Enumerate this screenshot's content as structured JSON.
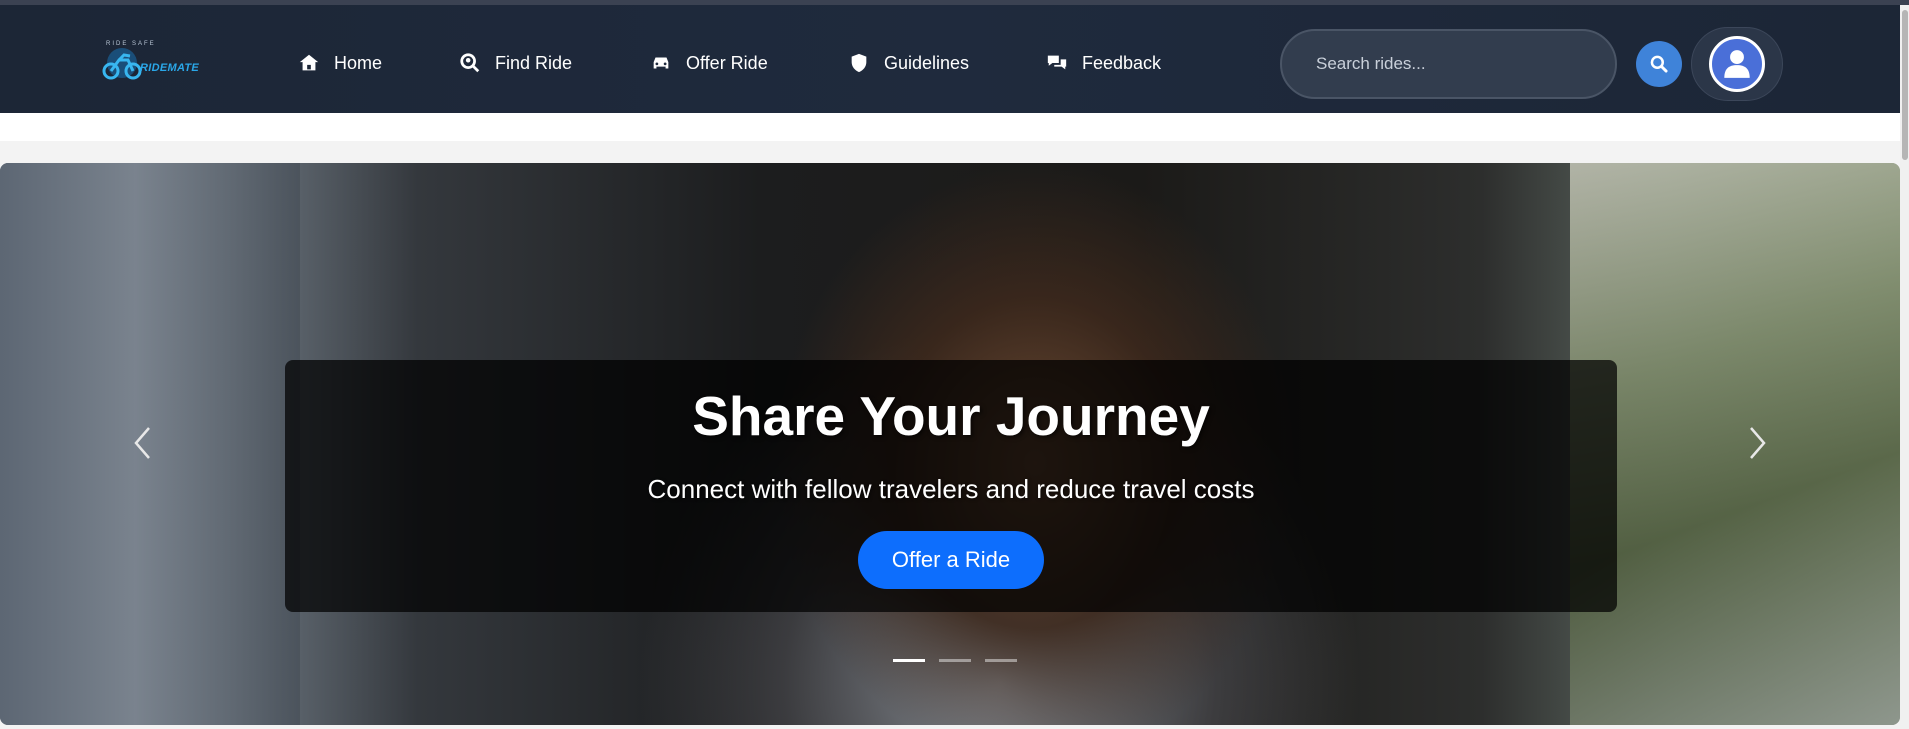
{
  "brand": {
    "name": "RIDEMATE",
    "tagline": "RIDE SAFE"
  },
  "nav": {
    "items": [
      {
        "label": "Home",
        "icon": "home-icon"
      },
      {
        "label": "Find Ride",
        "icon": "search-location-icon"
      },
      {
        "label": "Offer Ride",
        "icon": "car-icon"
      },
      {
        "label": "Guidelines",
        "icon": "shield-icon"
      },
      {
        "label": "Feedback",
        "icon": "comments-icon"
      }
    ]
  },
  "search": {
    "placeholder": "Search rides..."
  },
  "colors": {
    "navbar": "#1f2a3d",
    "accent": "#0d6efd",
    "search_button": "#3f83d9",
    "avatar": "#4a6fd8"
  },
  "hero": {
    "title": "Share Your Journey",
    "subtitle": "Connect with fellow travelers and reduce travel costs",
    "cta_label": "Offer a Ride",
    "slides_count": 3,
    "active_slide": 1
  }
}
